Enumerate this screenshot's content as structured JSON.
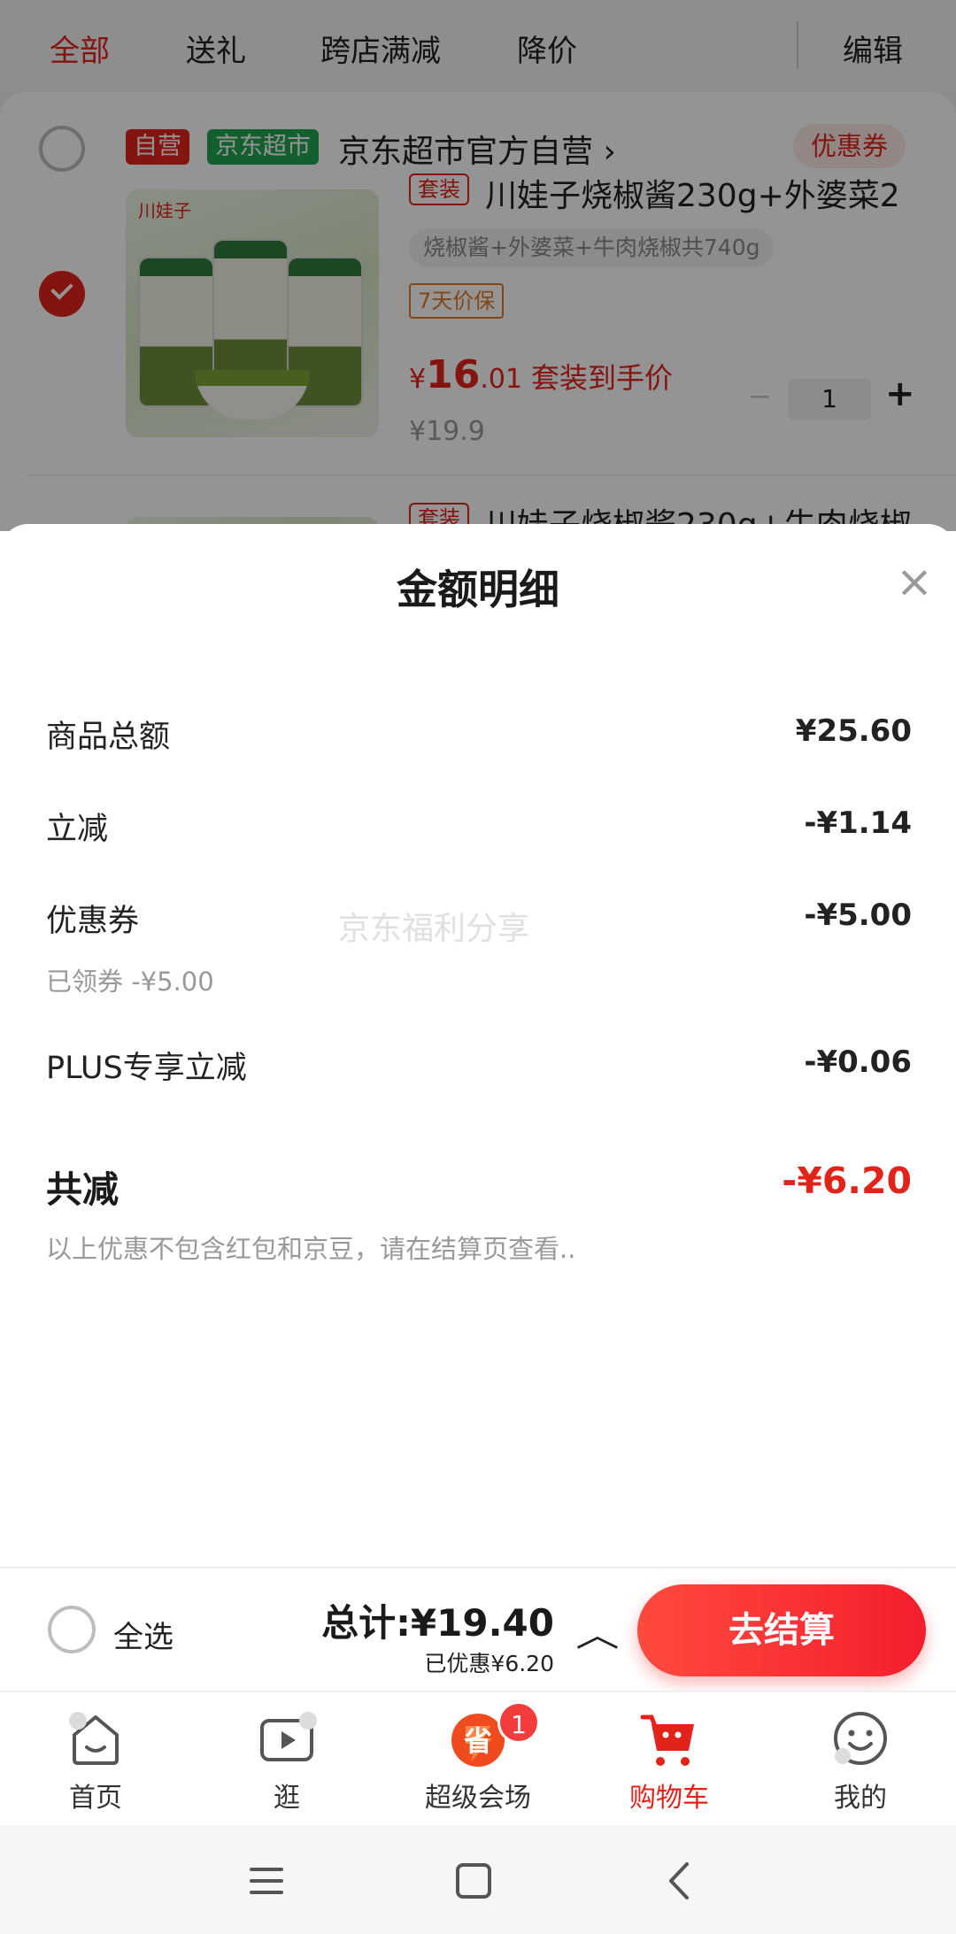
{
  "top_tabs": [
    "全部",
    "送礼",
    "跨店满减",
    "降价",
    "编辑"
  ],
  "shop": {
    "tag_self": "自营",
    "tag_market": "京东超市",
    "name": "京东超市官方自营 ›",
    "coupon_btn": "优惠券"
  },
  "product1": {
    "brand": "川娃子",
    "suit_tag": "套装",
    "title": "川娃子烧椒酱230g+外婆菜2",
    "spec": "烧椒酱+外婆菜+牛肉烧椒共740g",
    "guarantee": "7天价保",
    "price_symbol": "¥",
    "price_int": "16",
    "price_dec": ".01",
    "price_label": "套装到手价",
    "orig_price": "¥19.9",
    "qty_minus": "−",
    "qty": "1",
    "qty_plus": "+"
  },
  "product2": {
    "suit_tag": "套装",
    "title": "川娃子烧椒酱230g+牛肉烧椒"
  },
  "sheet": {
    "title": "金额明细",
    "close": "×",
    "rows": [
      {
        "label": "商品总额",
        "value": "¥25.60"
      },
      {
        "label": "立减",
        "value": "-¥1.14"
      },
      {
        "label": "优惠券",
        "value": "-¥5.00",
        "sub": "已领券 -¥5.00"
      },
      {
        "label": "PLUS专享立减",
        "value": "-¥0.06"
      }
    ],
    "total_label": "共减",
    "total_value": "-¥6.20",
    "note": "以上优惠不包含红包和京豆，请在结算页查看..",
    "watermark": "京东福利分享"
  },
  "checkout": {
    "select_all": "全选",
    "total": "总计:¥19.40",
    "saved": "已优惠¥6.20",
    "chevron": "︿",
    "button": "去结算"
  },
  "nav": {
    "items": [
      {
        "label": "首页",
        "icon": "home-icon"
      },
      {
        "label": "逛",
        "icon": "video-play-icon"
      },
      {
        "label": "超级会场",
        "icon": "super-venue-icon",
        "badge": "1",
        "icon_text": "省"
      },
      {
        "label": "购物车",
        "icon": "cart-icon",
        "active": true
      },
      {
        "label": "我的",
        "icon": "smiley-icon"
      }
    ]
  },
  "colors": {
    "accent": "#e2231a",
    "green_tag": "#23a452",
    "button_gradient_start": "#ff4a3d"
  }
}
